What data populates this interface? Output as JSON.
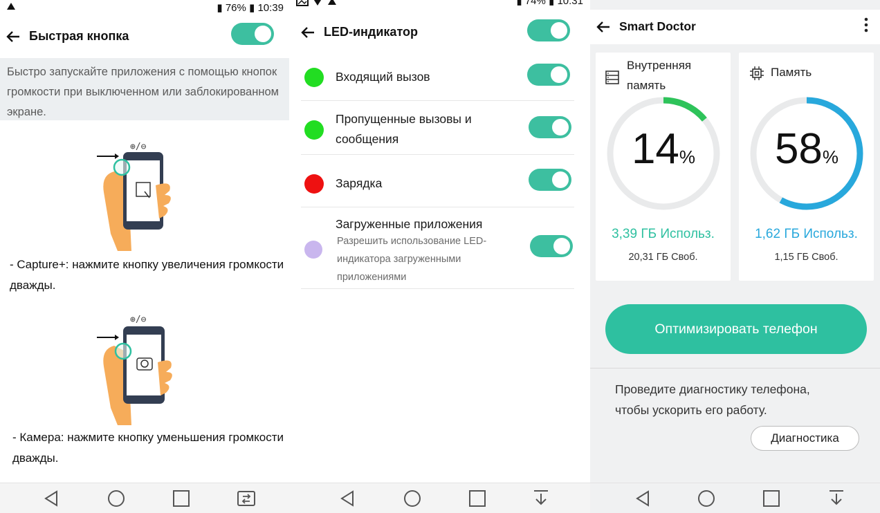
{
  "quick_button": {
    "status": {
      "battery": "76%",
      "time": "10:39"
    },
    "title": "Быстрая кнопка",
    "toggle_on": true,
    "description": "Быстро запускайте приложения с помощью кнопок громкости при выключенном или заблокированном экране.",
    "step1": "- Capture+: нажмите кнопку увеличения громкости дважды.",
    "step2": "- Камера: нажмите кнопку уменьшения громкости дважды."
  },
  "led": {
    "status": {
      "battery": "74%",
      "time": "10:31"
    },
    "title": "LED-индикатор",
    "master_toggle_on": true,
    "items": [
      {
        "label": "Входящий вызов",
        "color": "#22dd22",
        "on": true
      },
      {
        "label": "Пропущенные вызовы и сообщения",
        "color": "#22dd22",
        "on": true
      },
      {
        "label": "Зарядка",
        "color": "#ee1111",
        "on": true
      },
      {
        "label": "Загруженные приложения",
        "sublabel": "Разрешить использование LED-индикатора загруженными приложениями",
        "color": "#c9b6ee",
        "on": true
      }
    ]
  },
  "smart_doctor": {
    "title": "Smart Doctor",
    "internal": {
      "title": "Внутренняя память",
      "percent": 14,
      "used": "3,39 ГБ Использ.",
      "free": "20,31 ГБ Своб.",
      "ring_color": "#2ec35a",
      "used_color": "#2ec0a0"
    },
    "memory": {
      "title": "Память",
      "percent": 58,
      "used": "1,62 ГБ Использ.",
      "free": "1,15 ГБ Своб.",
      "ring_color": "#28a8dc",
      "used_color": "#28a8dc"
    },
    "optimize_button": "Оптимизировать телефон",
    "diagnostics_text": "Проведите диагностику телефона, чтобы ускорить его работу.",
    "diagnostics_button": "Диагностика"
  },
  "icons": [
    "back-arrow-icon",
    "nav-back-icon",
    "nav-home-icon",
    "nav-recents-icon",
    "nav-dualwindow-icon",
    "nav-notification-icon",
    "storage-icon",
    "chip-icon",
    "more-vert-icon"
  ]
}
